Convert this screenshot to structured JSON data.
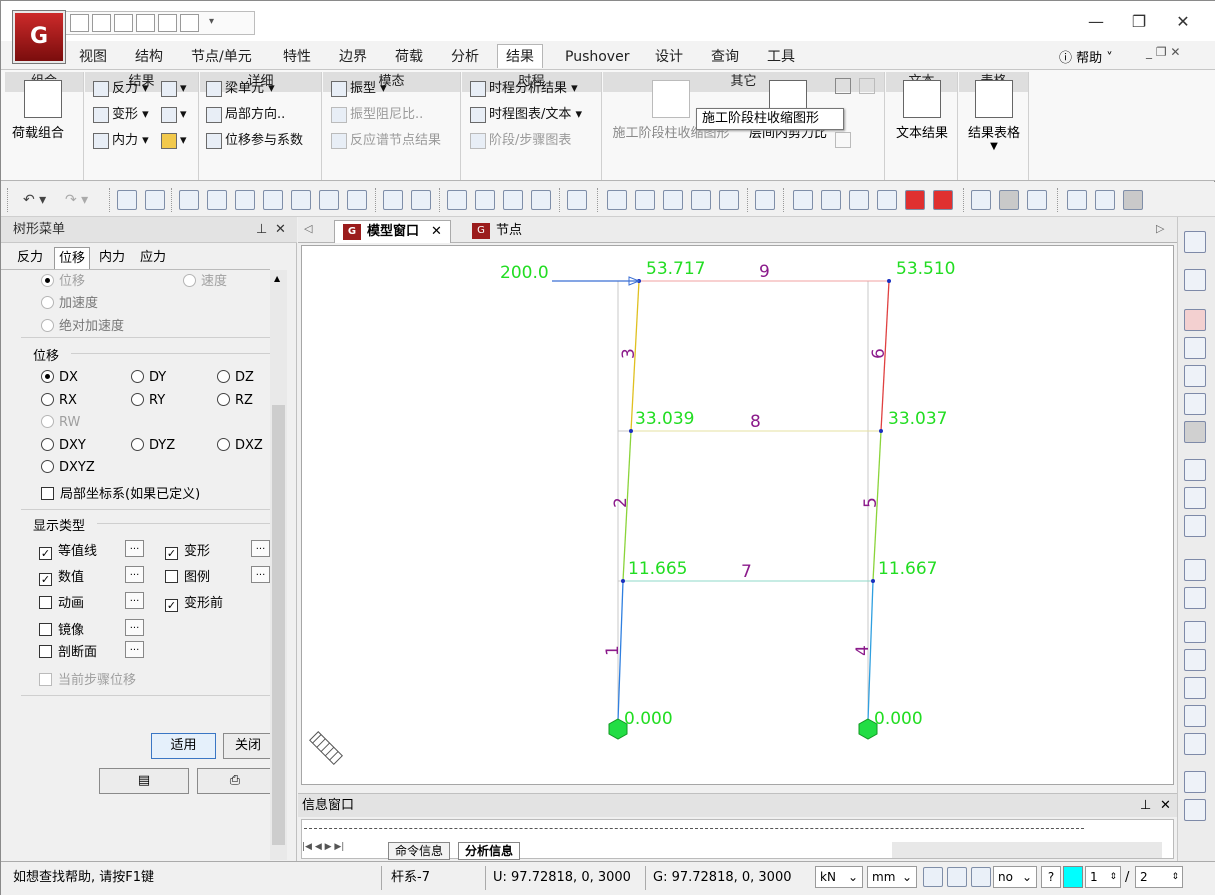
{
  "app": {
    "logo_text": "G"
  },
  "window": {
    "minimize": "—",
    "restore": "❐",
    "close": "✕"
  },
  "ribbon_tabs": [
    "视图",
    "结构",
    "节点/单元",
    "特性",
    "边界",
    "荷载",
    "分析",
    "结果",
    "Pushover",
    "设计",
    "查询",
    "工具"
  ],
  "active_tab": "结果",
  "help_label": "帮助",
  "ribbon": {
    "groups": [
      "组合",
      "结果",
      "详细",
      "模态",
      "时程",
      "其它",
      "文本",
      "表格"
    ],
    "load_combo": "荷载组合",
    "result_items": [
      "反力",
      "变形",
      "内力"
    ],
    "detail_items": [
      "梁单元",
      "局部方向..",
      "位移参与系数"
    ],
    "modal_items": [
      "振型",
      "振型阻尼比..",
      "反应谱节点结果"
    ],
    "timehistory_items": [
      "时程分析结果",
      "时程图表/文本",
      "阶段/步骤图表"
    ],
    "other_items": [
      "施工阶段柱收缩图形",
      "层间内剪力比"
    ],
    "text_result": "文本结果",
    "result_table": "结果表格"
  },
  "tooltip": "施工阶段柱收缩图形",
  "tree_menu": {
    "title": "树形菜单",
    "tabs": [
      "反力",
      "位移",
      "内力",
      "应力"
    ],
    "active_tab": "位移",
    "top_options": [
      "位移",
      "速度",
      "加速度",
      "绝对加速度"
    ],
    "disp_section": "位移",
    "disp_options": [
      "DX",
      "DY",
      "DZ",
      "RX",
      "RY",
      "RZ",
      "RW",
      "DXY",
      "DYZ",
      "DXZ",
      "DXYZ"
    ],
    "disp_selected": "DX",
    "local_axis": "局部坐标系(如果已定义)",
    "display_section": "显示类型",
    "display_options": [
      {
        "label": "等值线",
        "checked": true
      },
      {
        "label": "变形",
        "checked": true
      },
      {
        "label": "数值",
        "checked": true
      },
      {
        "label": "图例",
        "checked": false
      },
      {
        "label": "动画",
        "checked": false
      },
      {
        "label": "变形前",
        "checked": true
      },
      {
        "label": "镜像",
        "checked": false
      },
      {
        "label": "剖断面",
        "checked": false
      }
    ],
    "current_step": "当前步骤位移",
    "dots": "...",
    "apply": "适用",
    "close": "关闭"
  },
  "doc_tabs": [
    "模型窗口",
    "节点"
  ],
  "active_doc": "模型窗口",
  "model": {
    "load_value": "200.0",
    "node_values": [
      {
        "id": "n1",
        "value": "0.000"
      },
      {
        "id": "n2",
        "value": "11.665"
      },
      {
        "id": "n3",
        "value": "33.039"
      },
      {
        "id": "n4",
        "value": "53.717"
      },
      {
        "id": "n5",
        "value": "0.000"
      },
      {
        "id": "n6",
        "value": "11.667"
      },
      {
        "id": "n7",
        "value": "33.037"
      },
      {
        "id": "n8",
        "value": "53.510"
      }
    ],
    "element_labels": [
      "1",
      "2",
      "3",
      "4",
      "5",
      "6",
      "7",
      "8",
      "9"
    ],
    "colors": {
      "values": "#22dd22",
      "labels": "#8b1a8b",
      "load": "#3b6fd4"
    }
  },
  "info_window": {
    "title": "信息窗口",
    "tabs": [
      "命令信息",
      "分析信息"
    ],
    "active_tab": "分析信息"
  },
  "status": {
    "help": "如想查找帮助, 请按F1键",
    "element": "杆系-7",
    "u": "U: 97.72818, 0, 3000",
    "g": "G: 97.72818, 0, 3000",
    "force_unit": "kN",
    "length_unit": "mm",
    "mode": "no",
    "help_q": "?",
    "page": "1",
    "page_sep": "/",
    "page_total": "2"
  }
}
